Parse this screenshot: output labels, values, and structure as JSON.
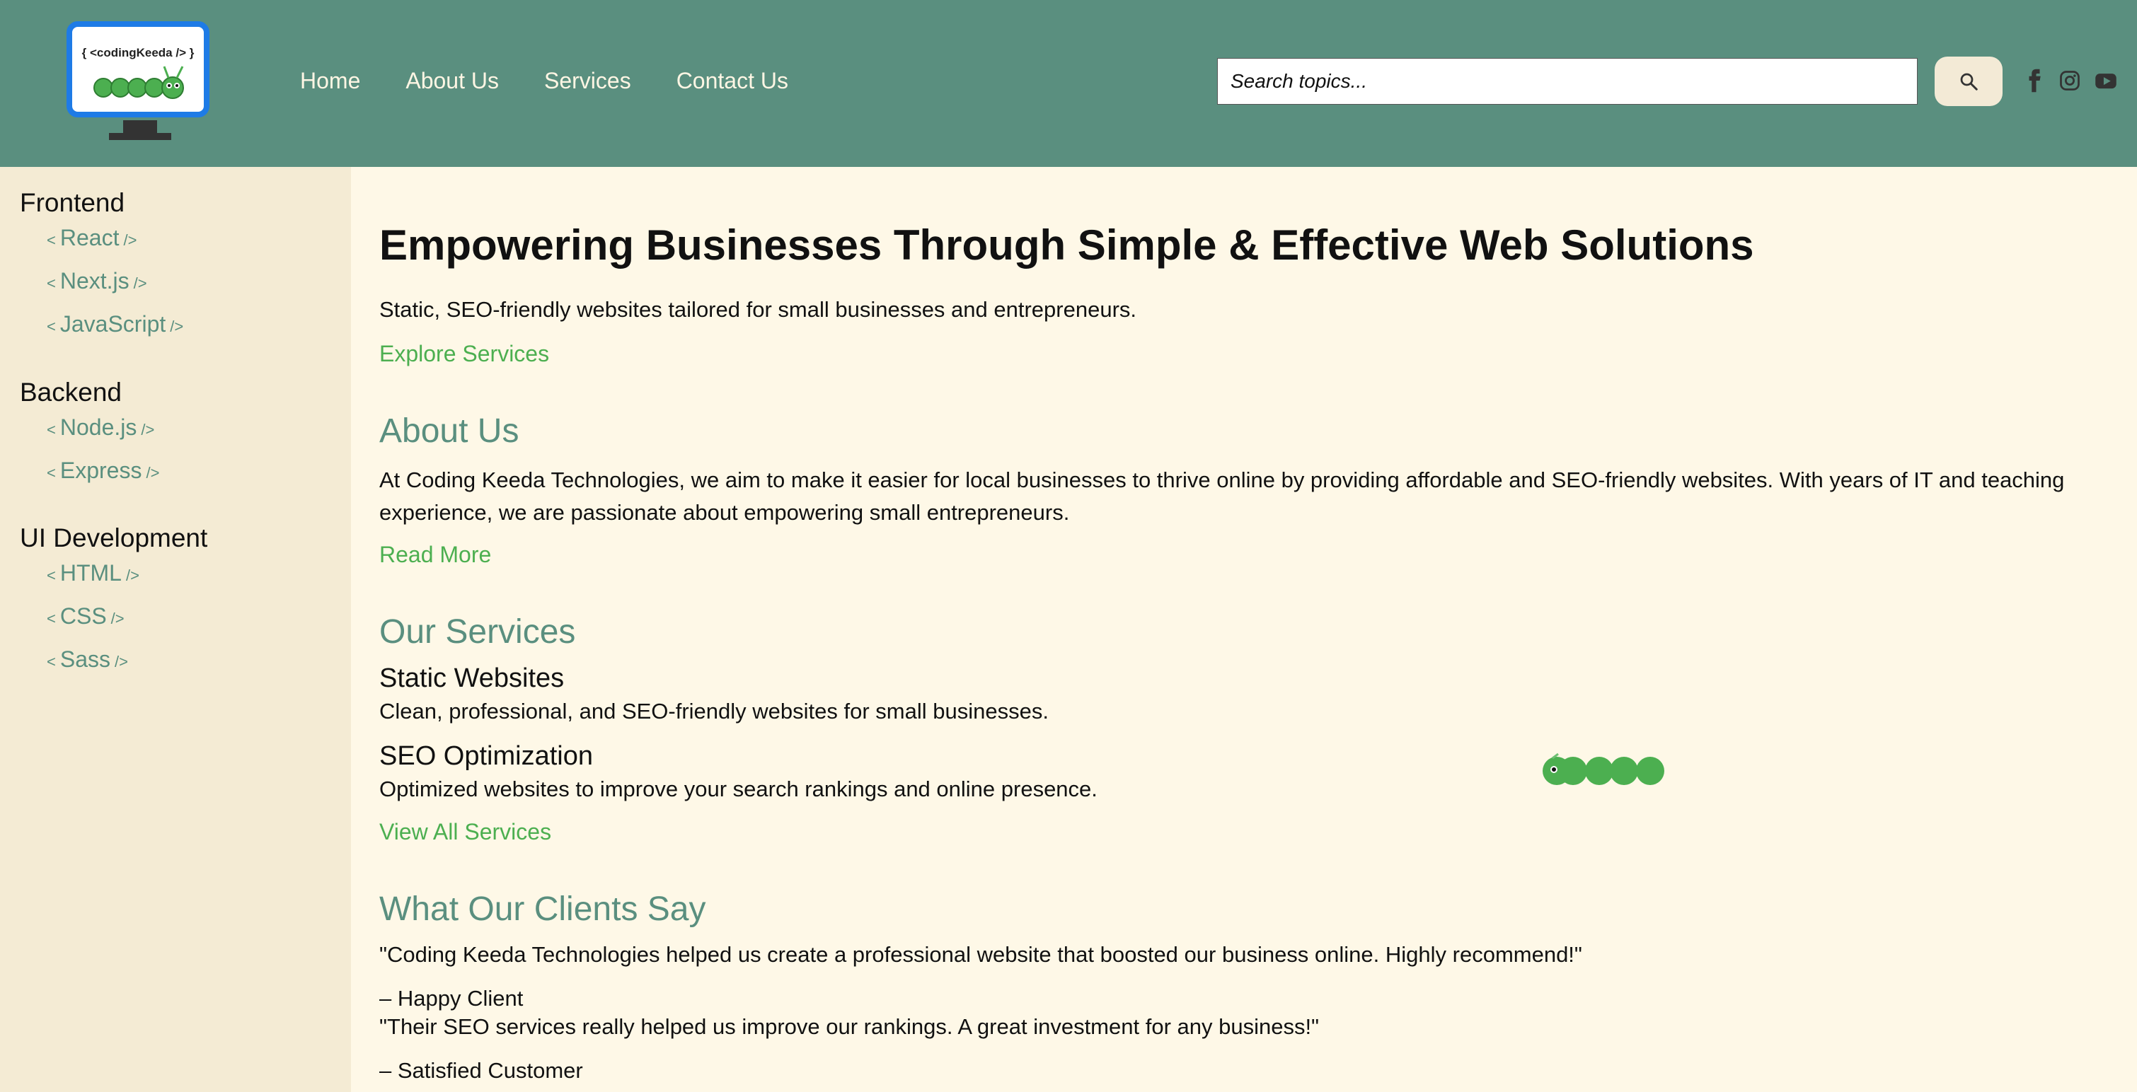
{
  "brand": {
    "logo_text": "{ <codingKeeda /> }"
  },
  "nav": {
    "items": [
      "Home",
      "About Us",
      "Services",
      "Contact Us"
    ]
  },
  "search": {
    "placeholder": "Search topics..."
  },
  "icons": {
    "search": "search-icon",
    "social": [
      "facebook-icon",
      "instagram-icon",
      "youtube-icon"
    ]
  },
  "sidebar": {
    "bracket_open": "<",
    "bracket_close": "/>",
    "sections": [
      {
        "title": "Frontend",
        "items": [
          "React",
          "Next.js",
          "JavaScript"
        ]
      },
      {
        "title": "Backend",
        "items": [
          "Node.js",
          "Express"
        ]
      },
      {
        "title": "UI Development",
        "items": [
          "HTML",
          "CSS",
          "Sass"
        ]
      }
    ]
  },
  "hero": {
    "title": "Empowering Businesses Through Simple & Effective Web Solutions",
    "subtitle": "Static, SEO-friendly websites tailored for small businesses and entrepreneurs.",
    "cta": "Explore Services"
  },
  "about": {
    "title": "About Us",
    "text": "At Coding Keeda Technologies, we aim to make it easier for local businesses to thrive online by providing affordable and SEO-friendly websites. With years of IT and teaching experience, we are passionate about empowering small entrepreneurs.",
    "cta": "Read More"
  },
  "services": {
    "title": "Our Services",
    "items": [
      {
        "name": "Static Websites",
        "desc": "Clean, professional, and SEO-friendly websites for small businesses."
      },
      {
        "name": "SEO Optimization",
        "desc": "Optimized websites to improve your search rankings and online presence."
      }
    ],
    "cta": "View All Services"
  },
  "testimonials": {
    "title": "What Our Clients Say",
    "items": [
      {
        "quote": "\"Coding Keeda Technologies helped us create a professional website that boosted our business online. Highly recommend!\"",
        "author": "– Happy Client"
      },
      {
        "quote": "\"Their SEO services really helped us improve our rankings. A great investment for any business!\"",
        "author": "– Satisfied Customer"
      }
    ]
  },
  "colors": {
    "header": "#5a8f7f",
    "sidebar": "#f4ebd4",
    "page": "#fef8e7",
    "accent_green": "#4caf50",
    "teal_text": "#5a8f7f",
    "logo_border": "#1e7be6"
  }
}
